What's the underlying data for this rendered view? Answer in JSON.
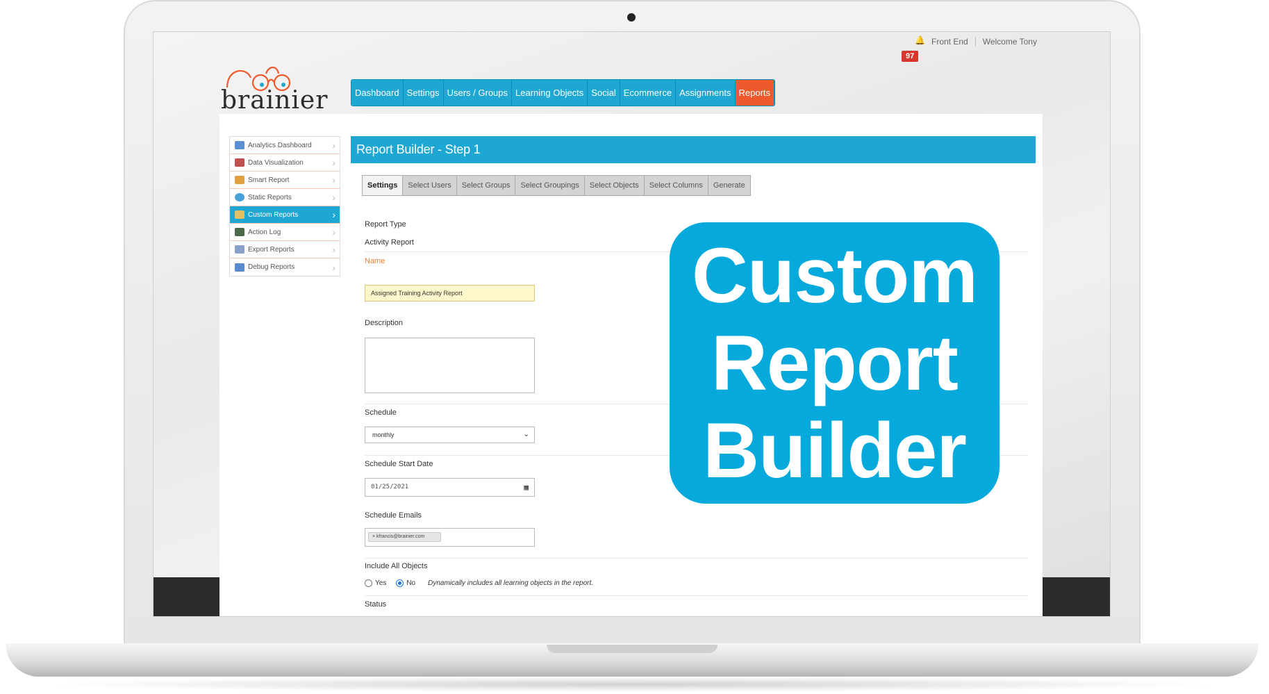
{
  "topbar": {
    "notification_count": "97",
    "front_end_link": "Front End",
    "welcome_text": "Welcome Tony"
  },
  "logo": {
    "text": "brainier"
  },
  "main_nav": [
    {
      "label": "Dashboard",
      "active": false
    },
    {
      "label": "Settings",
      "active": false
    },
    {
      "label": "Users / Groups",
      "active": false
    },
    {
      "label": "Learning Objects",
      "active": false
    },
    {
      "label": "Social",
      "active": false
    },
    {
      "label": "Ecommerce",
      "active": false
    },
    {
      "label": "Assignments",
      "active": false
    },
    {
      "label": "Reports",
      "active": true
    }
  ],
  "sidebar": {
    "items": [
      {
        "label": "Analytics Dashboard",
        "icon": "analytics-icon",
        "color": "#5b8fd6"
      },
      {
        "label": "Data Visualization",
        "icon": "bar-chart-icon",
        "color": "#c0504d"
      },
      {
        "label": "Smart Report",
        "icon": "smart-report-icon",
        "color": "#e0a040"
      },
      {
        "label": "Static Reports",
        "icon": "globe-icon",
        "color": "#4aa0d8"
      },
      {
        "label": "Custom Reports",
        "icon": "custom-report-icon",
        "color": "#e6c060",
        "active": true
      },
      {
        "label": "Action Log",
        "icon": "log-icon",
        "color": "#4a6a4a"
      },
      {
        "label": "Export Reports",
        "icon": "export-icon",
        "color": "#8aa0c8"
      },
      {
        "label": "Debug Reports",
        "icon": "debug-icon",
        "color": "#5a8ad0"
      }
    ]
  },
  "report_builder": {
    "title": "Report Builder - Step 1",
    "steps": [
      {
        "label": "Settings",
        "active": true
      },
      {
        "label": "Select Users"
      },
      {
        "label": "Select Groups"
      },
      {
        "label": "Select Groupings"
      },
      {
        "label": "Select Objects"
      },
      {
        "label": "Select Columns"
      },
      {
        "label": "Generate"
      }
    ]
  },
  "form": {
    "report_type_label": "Report Type",
    "report_type_value": "Activity Report",
    "name_label": "Name",
    "name_value": "Assigned Training Activity Report",
    "description_label": "Description",
    "schedule_label": "Schedule",
    "schedule_value": "monthly",
    "start_date_label": "Schedule Start Date",
    "start_date_value": "01/25/2021",
    "emails_label": "Schedule Emails",
    "email_chip": "× kfrancis@brainier.com",
    "include_all_label": "Include All Objects",
    "radio_yes": "Yes",
    "radio_no": "No",
    "radio_selected": "No",
    "include_hint": "Dynamically includes all learning objects in the report.",
    "status_label": "Status"
  },
  "callout": {
    "line1": "Custom",
    "line2": "Report",
    "line3": "Builder"
  }
}
